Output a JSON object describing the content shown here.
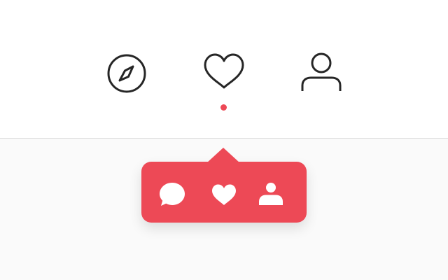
{
  "nav": {
    "items": [
      {
        "id": "explore",
        "icon": "compass-icon"
      },
      {
        "id": "activity",
        "icon": "heart-outline-icon",
        "has_notification_dot": true
      },
      {
        "id": "profile",
        "icon": "user-outline-icon"
      }
    ]
  },
  "activity_tooltip": {
    "items": [
      {
        "id": "comments",
        "icon": "comment-bubble-icon"
      },
      {
        "id": "likes",
        "icon": "heart-filled-icon"
      },
      {
        "id": "followers",
        "icon": "user-filled-icon"
      }
    ]
  },
  "colors": {
    "accent": "#ed4956",
    "icon_stroke": "#262626",
    "nav_background": "#ffffff",
    "page_background": "#fafafa",
    "divider": "#dbdbdb",
    "tooltip_icon": "#ffffff"
  }
}
